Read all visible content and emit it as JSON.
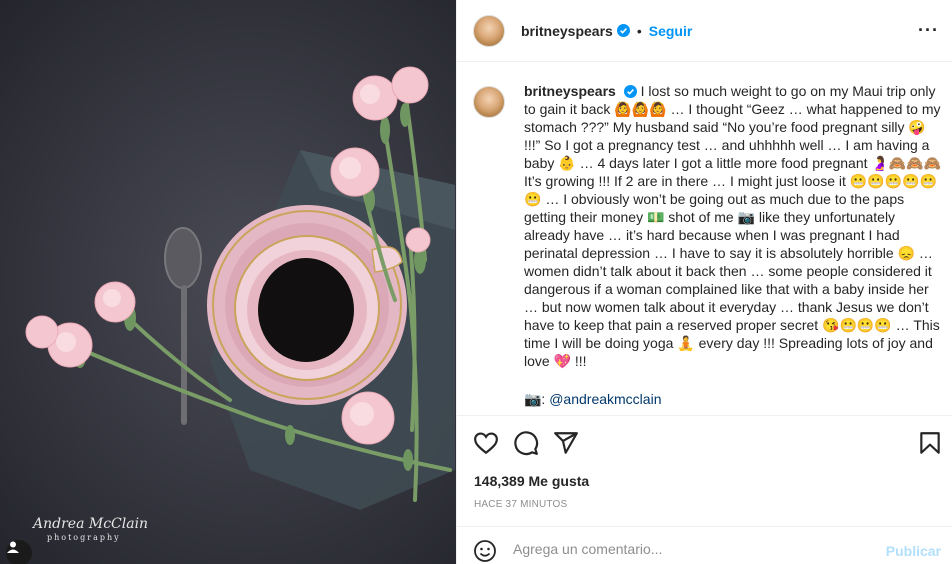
{
  "post": {
    "username": "britneyspears",
    "follow_label": "Seguir",
    "separator": "•",
    "more_label": "···",
    "caption_username": "britneyspears",
    "caption": "I lost so much weight to go on my Maui trip only to gain it back 🙆🙆🙆 … I thought “Geez … what happened to my stomach ???” My husband said “No you’re food pregnant silly 🤪 !!!” So I got a pregnancy test … and uhhhhh well … I am having a baby 👶 … 4 days later I got a little more food pregnant 🤰🙈🙈🙈 It’s growing !!! If 2 are in there … I might just loose it 😬😬😬😬😬😬 … I obviously won’t be going out as much due to the paps getting their money 💵 shot of me 📷 like they unfortunately already have … it’s hard because when I was pregnant I had perinatal depression … I have to say it is absolutely horrible 😞 … women didn’t talk about it back then … some people considered it dangerous if a woman complained like that with a baby inside her … but now women talk about it everyday … thank Jesus we don’t have to keep that pain a reserved proper secret 😘😬😬😬 … This time I will be doing yoga 🧘 every day !!! Spreading lots of joy and love 💖 !!!",
    "credit_icon": "📷:",
    "credit_handle": "@andreakmcclain",
    "likes_count": "148,389",
    "likes_label": "Me gusta",
    "time_ago": "HACE 37 MINUTOS",
    "comment_placeholder": "Agrega un comentario...",
    "publish_label": "Publicar",
    "watermark_name": "Andrea McClain",
    "watermark_sub": "photography"
  },
  "icons": {
    "verified": "verified-badge",
    "like": "heart-icon",
    "comment": "comment-icon",
    "share": "send-icon",
    "save": "bookmark-icon",
    "emoji": "smiley-icon",
    "tagged": "user-tag-icon"
  },
  "colors": {
    "accent": "#0095f6",
    "publish_disabled": "#b2dffc",
    "link": "#00376b",
    "muted": "#8e8e8e"
  }
}
